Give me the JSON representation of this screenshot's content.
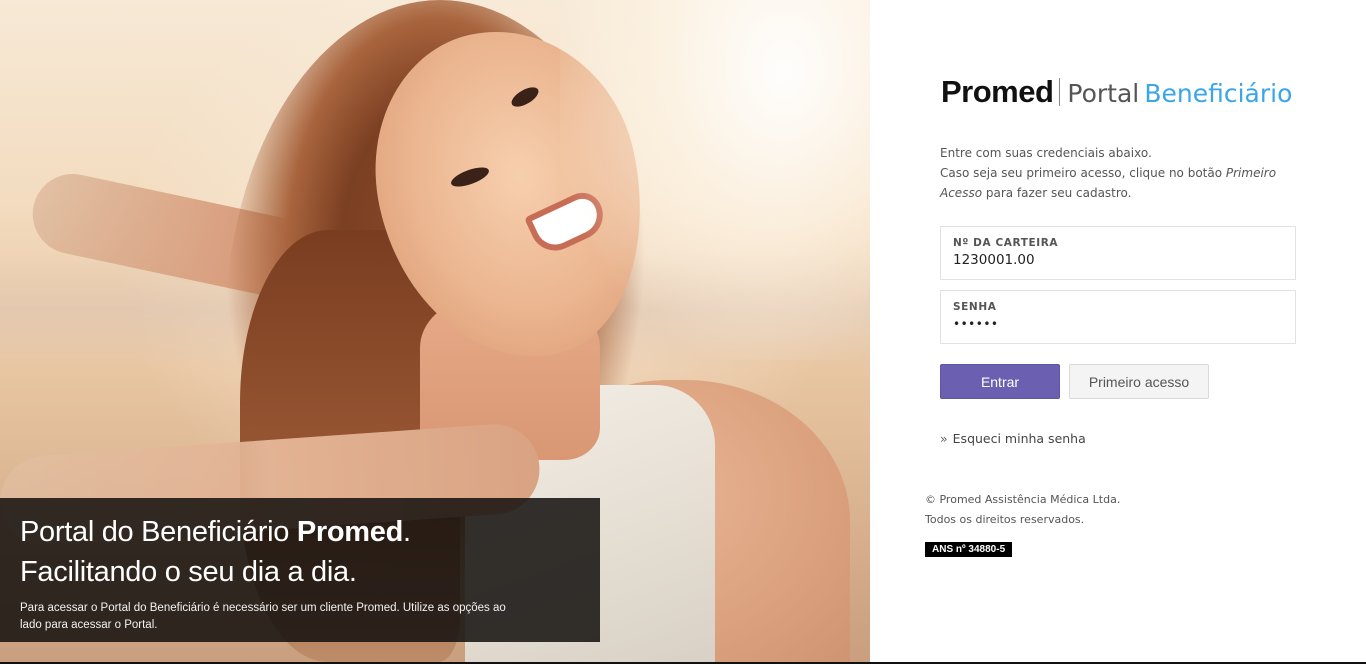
{
  "caption": {
    "line1_prefix": "Portal do Beneficiário ",
    "line1_brand": "Promed",
    "line1_suffix": ".",
    "line2": "Facilitando o seu dia a dia.",
    "note": "Para acessar o Portal do Beneficiário é necessário ser um cliente Promed. Utilize as opções ao lado para acessar o Portal."
  },
  "brand": {
    "logo": "Promed",
    "portal": "Portal",
    "beneficiario": "Beneficiário",
    "accent_color": "#3aa6e8"
  },
  "intro": {
    "line1": "Entre com suas credenciais abaixo.",
    "line2_prefix": "Caso seja seu primeiro acesso, clique no botão ",
    "line2_em": "Primeiro Acesso",
    "line2_suffix": " para fazer seu cadastro."
  },
  "form": {
    "card_label": "Nº DA CARTEIRA",
    "card_value": "1230001.00",
    "password_label": "SENHA",
    "password_value": "••••••"
  },
  "buttons": {
    "login": "Entrar",
    "first_access": "Primeiro acesso",
    "primary_color": "#6a5fb0"
  },
  "links": {
    "forgot_prefix": "»",
    "forgot": "Esqueci minha senha"
  },
  "footer": {
    "copyright": "© Promed Assistência Médica Ltda.",
    "rights": "Todos os direitos reservados.",
    "ans": "ANS nº 34880-5"
  }
}
